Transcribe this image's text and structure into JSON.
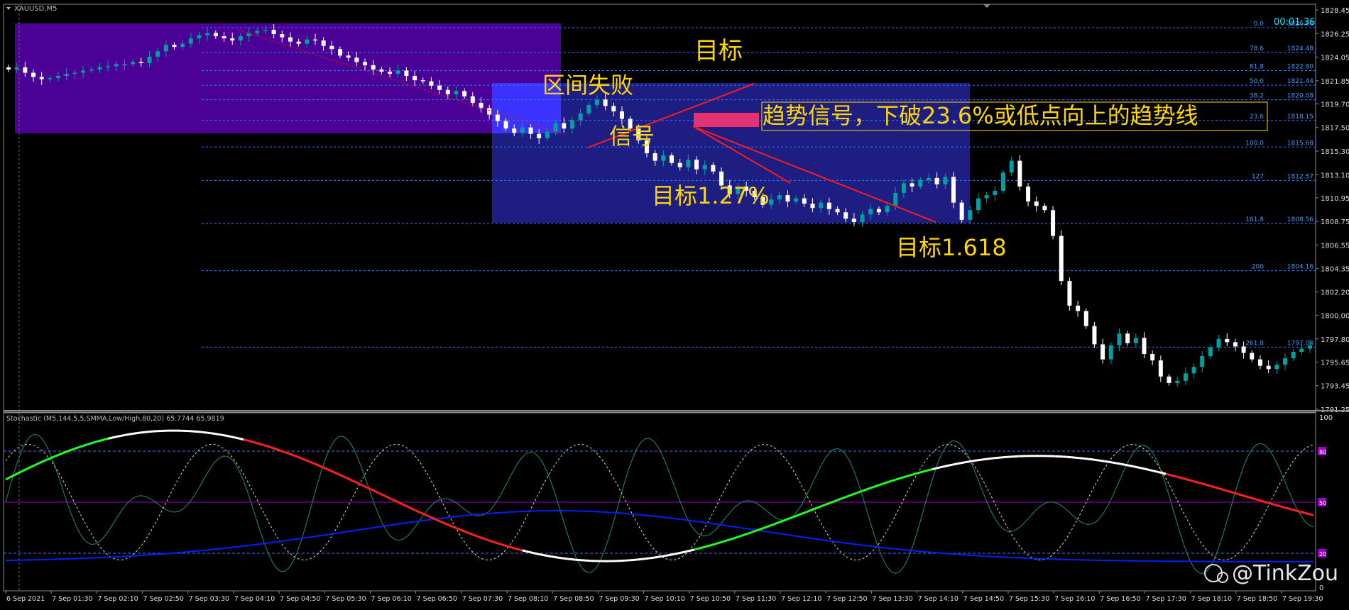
{
  "window": {
    "symbol": "XAUUSD,M5",
    "countdown": "00:01:36",
    "watermark": "@TinkZou"
  },
  "colors": {
    "up_candle": "#00a0a0",
    "down_candle": "#ffffff",
    "fib_line": "#3a78ff",
    "fib_text": "#3a9bff",
    "annotation_text": "#ffd700",
    "trend_line": "#ff1a1a",
    "zone_purple": "#4b0096",
    "zone_blue": "#1e1e82",
    "zone_blue_bright": "#3c32ff",
    "signal_box": "#e8306e",
    "stoch_base": "#ffffff",
    "stoch_down": "#ff2020",
    "stoch_up": "#20ff20",
    "stoch_blue": "#0020ff",
    "stoch_level": "#a000c8"
  },
  "annotations": [
    {
      "id": "target-top",
      "text": "目标"
    },
    {
      "id": "range-fail",
      "text": "区间失败"
    },
    {
      "id": "signal",
      "text": "信号"
    },
    {
      "id": "trend-signal",
      "text": "趋势信号，下破23.6%或低点向上的趋势线"
    },
    {
      "id": "target-127",
      "text": "目标1.27%"
    },
    {
      "id": "target-1618",
      "text": "目标1.618"
    }
  ],
  "stochastic": {
    "label": "Stochastic (M5,144,5,5,SMMA,Low/High,80,20) 65.7744 65.9819",
    "levels": [
      {
        "value": 80,
        "label": "80"
      },
      {
        "value": 50,
        "label": "50"
      },
      {
        "value": 20,
        "label": "20"
      }
    ],
    "scale": {
      "top": "100",
      "bottom": "0"
    }
  },
  "chart_data": {
    "type": "candlestick",
    "symbol": "XAUUSD",
    "timeframe": "M5",
    "ylim": [
      1791.25,
      1828.45
    ],
    "price_axis_ticks": [
      1828.45,
      1826.25,
      1824.05,
      1821.85,
      1819.7,
      1817.5,
      1815.3,
      1813.1,
      1810.95,
      1808.75,
      1806.55,
      1804.35,
      1802.2,
      1800.0,
      1797.8,
      1795.65,
      1793.45,
      1791.25
    ],
    "price_axis_labels": [
      "1828.45",
      "1826.25",
      "1824.05",
      "1821.85",
      "1819.70",
      "1817.50",
      "1815.30",
      "1813.10",
      "1810.95",
      "1808.75",
      "1806.55",
      "1804.35",
      "1802.20",
      "1800.00",
      "1797.80",
      "1795.65",
      "1793.45",
      "1791.25"
    ],
    "time_labels": [
      "6 Sep 2021",
      "7 Sep 01:30",
      "7 Sep 02:10",
      "7 Sep 02:50",
      "7 Sep 03:30",
      "7 Sep 04:10",
      "7 Sep 04:50",
      "7 Sep 05:30",
      "7 Sep 06:10",
      "7 Sep 06:50",
      "7 Sep 07:30",
      "7 Sep 08:10",
      "7 Sep 08:50",
      "7 Sep 09:30",
      "7 Sep 10:10",
      "7 Sep 10:50",
      "7 Sep 11:30",
      "7 Sep 12:10",
      "7 Sep 12:50",
      "7 Sep 13:30",
      "7 Sep 14:10",
      "7 Sep 14:50",
      "7 Sep 15:30",
      "7 Sep 16:10",
      "7 Sep 16:50",
      "7 Sep 17:30",
      "7 Sep 18:10",
      "7 Sep 18:50",
      "7 Sep 19:30"
    ],
    "fib_levels": [
      {
        "ratio": "0.0",
        "price": 1826.8,
        "label": "1826.80"
      },
      {
        "ratio": "78.6",
        "price": 1824.48,
        "label": "1824.48"
      },
      {
        "ratio": "61.8",
        "price": 1822.8,
        "label": "1822.80"
      },
      {
        "ratio": "50.0",
        "price": 1821.44,
        "label": "1821.44"
      },
      {
        "ratio": "38.2",
        "price": 1820.08,
        "label": "1820.08"
      },
      {
        "ratio": "23.6",
        "price": 1818.15,
        "label": "1818.15"
      },
      {
        "ratio": "100.0",
        "price": 1815.68,
        "label": "1815.68"
      },
      {
        "ratio": "127",
        "price": 1812.57,
        "label": "1812.57"
      },
      {
        "ratio": "161.8",
        "price": 1808.56,
        "label": "1808.56"
      },
      {
        "ratio": "200",
        "price": 1804.16,
        "label": "1804.16"
      },
      {
        "ratio": "261.8",
        "price": 1797.04,
        "label": "1797.04"
      }
    ],
    "closes": [
      1822.9,
      1823.1,
      1822.6,
      1822.2,
      1822.0,
      1822.1,
      1822.3,
      1822.5,
      1822.6,
      1822.8,
      1822.9,
      1823.1,
      1823.2,
      1823.4,
      1823.4,
      1823.6,
      1823.5,
      1824.1,
      1824.6,
      1825.2,
      1825.0,
      1825.3,
      1825.8,
      1826.1,
      1826.3,
      1826.0,
      1825.8,
      1825.6,
      1826.0,
      1826.3,
      1826.5,
      1826.6,
      1826.2,
      1825.9,
      1825.5,
      1825.3,
      1825.7,
      1825.6,
      1825.1,
      1824.8,
      1824.2,
      1824.0,
      1823.6,
      1823.3,
      1822.9,
      1822.7,
      1822.5,
      1822.8,
      1822.3,
      1821.9,
      1821.8,
      1821.4,
      1821.0,
      1820.6,
      1820.9,
      1820.4,
      1819.8,
      1819.3,
      1818.7,
      1818.1,
      1817.4,
      1817.0,
      1817.5,
      1816.9,
      1816.5,
      1817.1,
      1817.9,
      1817.4,
      1818.2,
      1818.8,
      1819.6,
      1820.1,
      1819.5,
      1819.0,
      1818.3,
      1817.4,
      1816.3,
      1815.1,
      1814.4,
      1814.9,
      1814.2,
      1813.8,
      1814.5,
      1813.6,
      1814.0,
      1813.4,
      1812.1,
      1811.3,
      1812.0,
      1811.6,
      1811.0,
      1810.3,
      1810.8,
      1811.2,
      1810.6,
      1810.9,
      1810.4,
      1810.0,
      1810.5,
      1809.9,
      1809.6,
      1809.0,
      1808.7,
      1809.4,
      1809.9,
      1809.6,
      1810.2,
      1811.4,
      1812.3,
      1812.0,
      1812.6,
      1812.8,
      1812.2,
      1812.9,
      1810.5,
      1808.9,
      1809.8,
      1810.9,
      1811.2,
      1811.6,
      1813.3,
      1814.4,
      1812.0,
      1810.6,
      1810.2,
      1809.8,
      1807.4,
      1803.2,
      1800.9,
      1800.4,
      1799.0,
      1797.3,
      1795.9,
      1797.2,
      1798.3,
      1797.4,
      1797.9,
      1796.4,
      1795.8,
      1794.3,
      1793.7,
      1793.9,
      1794.6,
      1795.2,
      1796.2,
      1797.0,
      1797.8,
      1797.5,
      1797.1,
      1796.5,
      1795.9,
      1795.3,
      1795.0,
      1795.4,
      1796.0,
      1796.6,
      1796.9,
      1797.2
    ]
  }
}
